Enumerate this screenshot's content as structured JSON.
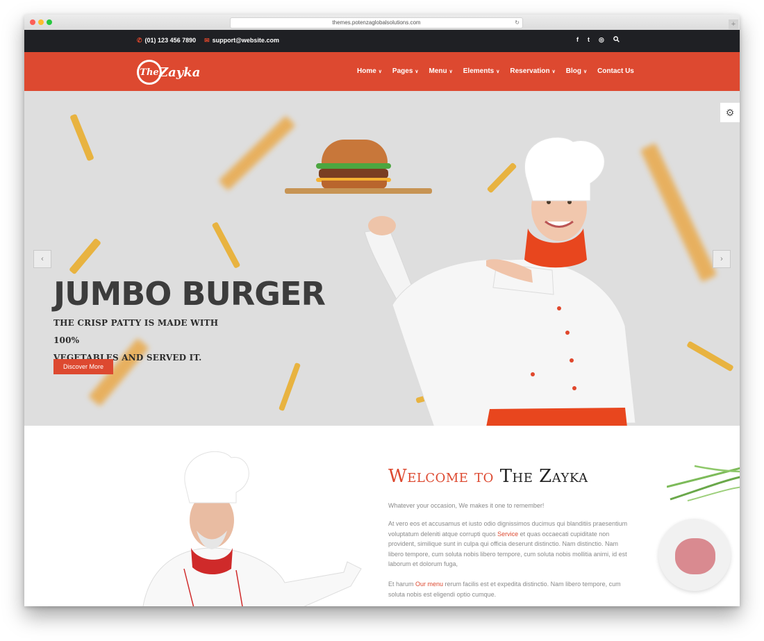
{
  "browser": {
    "url": "themes.potenzaglobalsolutions.com",
    "reload_icon": "reload-icon"
  },
  "topbar": {
    "phone_icon": "phone-icon",
    "phone": "(01) 123 456 7890",
    "email_icon": "envelope-icon",
    "email": "support@website.com",
    "socials": [
      {
        "icon": "facebook-icon",
        "glyph": "f"
      },
      {
        "icon": "twitter-icon",
        "glyph": "🐦"
      },
      {
        "icon": "instagram-icon",
        "glyph": "◎"
      },
      {
        "icon": "search-icon",
        "glyph": "⌕"
      }
    ]
  },
  "header": {
    "logo_mark": "The",
    "logo_text": "Zayka",
    "nav": [
      {
        "label": "Home",
        "dropdown": true
      },
      {
        "label": "Pages",
        "dropdown": true
      },
      {
        "label": "Menu",
        "dropdown": true
      },
      {
        "label": "Elements",
        "dropdown": true
      },
      {
        "label": "Reservation",
        "dropdown": true
      },
      {
        "label": "Blog",
        "dropdown": true
      },
      {
        "label": "Contact Us",
        "dropdown": false
      }
    ]
  },
  "hero": {
    "title": "JUMBO BURGER",
    "subtitle_line1": "THE CRISP PATTY IS MADE WITH 100%",
    "subtitle_line2": "VEGETABLES AND SERVED IT.",
    "cta": "Discover More",
    "prev_glyph": "‹",
    "next_glyph": "›",
    "settings_glyph": "⚙"
  },
  "welcome": {
    "title_accent": "Welcome to",
    "title_rest": "The Zayka",
    "tagline": "Whatever your occasion, We makes it one to remember!",
    "para1_a": "At vero eos et accusamus et iusto odio dignissimos ducimus qui blanditiis praesentium voluptatum deleniti atque corrupti quos ",
    "para1_link": "Service",
    "para1_b": " et quas occaecati cupiditate non provident, similique sunt in culpa qui officia deserunt distinctio. Nam distinctio. Nam libero tempore, cum soluta nobis libero tempore, cum soluta nobis mollitia animi, id est laborum et dolorum fuga,",
    "para2_a": "Et harum ",
    "para2_link": "Our menu",
    "para2_b": " rerum facilis est et expedita distinctio. Nam libero tempore, cum soluta nobis est eligendi optio cumque."
  },
  "colors": {
    "brand": "#dd4930",
    "topbar": "#1f2024",
    "hero_bg": "#dedede"
  }
}
